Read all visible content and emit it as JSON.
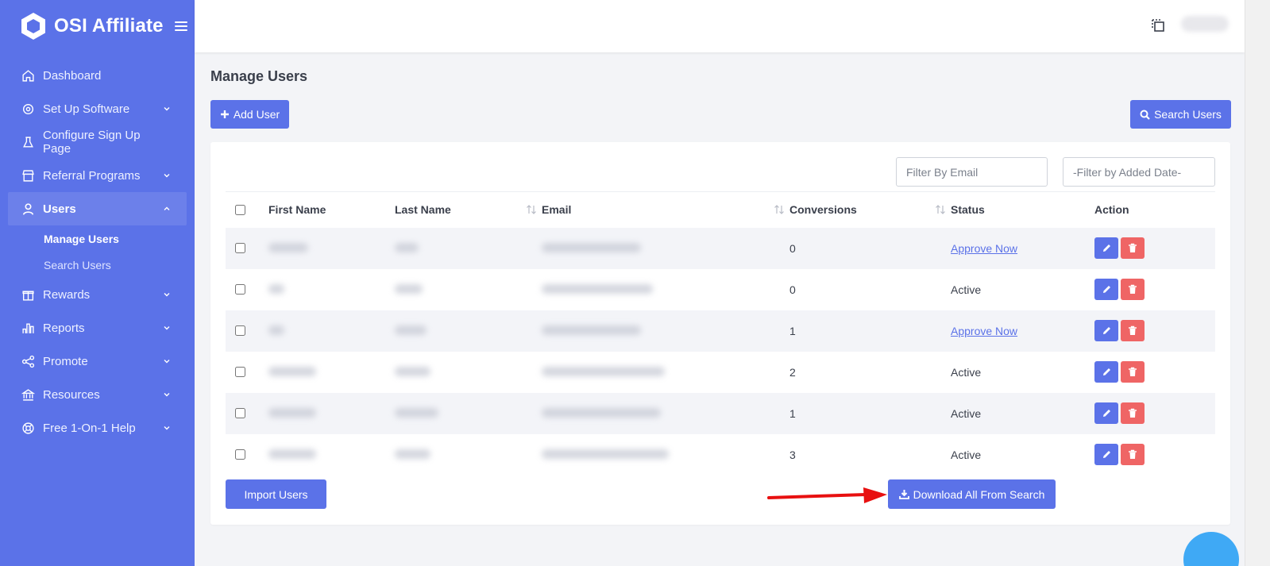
{
  "brand": {
    "name": "OSI Affiliate"
  },
  "sidebar": {
    "items": [
      {
        "label": "Dashboard",
        "icon": "home-icon"
      },
      {
        "label": "Set Up Software",
        "icon": "gear-icon",
        "expandable": true
      },
      {
        "label": "Configure Sign Up Page",
        "icon": "flask-icon"
      },
      {
        "label": "Referral Programs",
        "icon": "store-icon",
        "expandable": true
      },
      {
        "label": "Users",
        "icon": "user-icon",
        "expandable": true,
        "expanded": true
      },
      {
        "label": "Rewards",
        "icon": "gift-icon",
        "expandable": true
      },
      {
        "label": "Reports",
        "icon": "bar-chart-icon",
        "expandable": true
      },
      {
        "label": "Promote",
        "icon": "share-icon",
        "expandable": true
      },
      {
        "label": "Resources",
        "icon": "bank-icon",
        "expandable": true
      },
      {
        "label": "Free 1-On-1 Help",
        "icon": "lifebuoy-icon",
        "expandable": true
      }
    ],
    "users_sub": [
      {
        "label": "Manage Users",
        "current": true
      },
      {
        "label": "Search Users",
        "current": false
      }
    ]
  },
  "page": {
    "title": "Manage Users",
    "add_user_label": "Add User",
    "search_users_label": "Search Users",
    "filter_email_placeholder": "Filter By Email",
    "filter_date_placeholder": "-Filter by Added Date-",
    "import_label": "Import Users",
    "download_label": "Download All From Search"
  },
  "table": {
    "headers": {
      "first_name": "First Name",
      "last_name": "Last Name",
      "email": "Email",
      "conversions": "Conversions",
      "status": "Status",
      "action": "Action"
    },
    "rows": [
      {
        "conversions": "0",
        "status": "Approve Now",
        "status_link": true
      },
      {
        "conversions": "0",
        "status": "Active",
        "status_link": false
      },
      {
        "conversions": "1",
        "status": "Approve Now",
        "status_link": true
      },
      {
        "conversions": "2",
        "status": "Active",
        "status_link": false
      },
      {
        "conversions": "1",
        "status": "Active",
        "status_link": false
      },
      {
        "conversions": "3",
        "status": "Active",
        "status_link": false
      }
    ]
  },
  "colors": {
    "primary": "#5b72e8",
    "danger": "#ef6565",
    "annotation_arrow": "#e81010"
  }
}
